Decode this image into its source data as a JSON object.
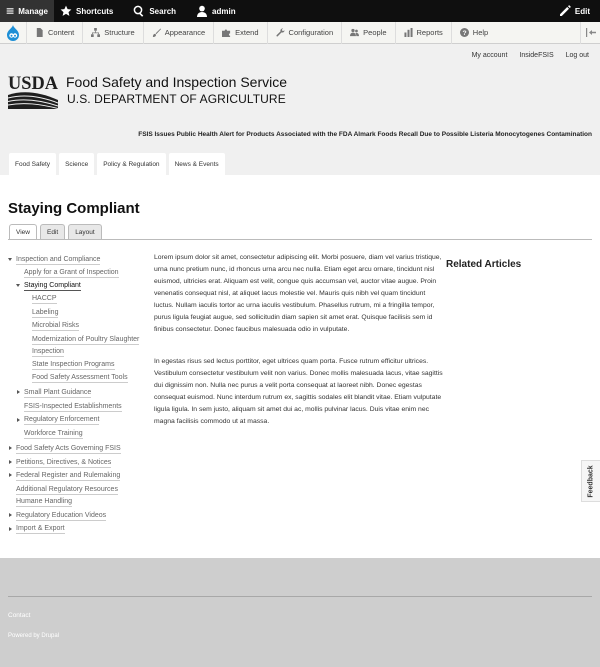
{
  "toolbar": {
    "manage": "Manage",
    "shortcuts": "Shortcuts",
    "search": "Search",
    "user": "admin",
    "edit": "Edit"
  },
  "tray": {
    "items": [
      "Content",
      "Structure",
      "Appearance",
      "Extend",
      "Configuration",
      "People",
      "Reports",
      "Help"
    ]
  },
  "header": {
    "secondary_nav": [
      "My account",
      "InsideFSIS",
      "Log out"
    ],
    "logo_text": "USDA",
    "site_name": "Food Safety and Inspection Service",
    "site_sub": "U.S. DEPARTMENT OF AGRICULTURE",
    "alert": "FSIS Issues Public Health Alert for Products Associated with the FDA Almark Foods Recall Due to Possible Listeria Monocytogenes Contamination",
    "main_nav": [
      "Food Safety",
      "Science",
      "Policy & Regulation",
      "News & Events"
    ]
  },
  "page": {
    "title": "Staying Compliant",
    "tabs": [
      "View",
      "Edit",
      "Layout"
    ],
    "related_title": "Related Articles",
    "paragraphs": [
      "Lorem ipsum dolor sit amet, consectetur adipiscing elit. Morbi posuere, diam vel varius tristique, urna nunc pretium nunc, id rhoncus urna arcu nec nulla. Etiam eget arcu ornare, tincidunt nisl euismod, ultricies erat. Aliquam est velit, congue quis accumsan vel, auctor vitae augue. Proin venenatis consequat nisl, at aliquet lacus molestie vel. Mauris quis nibh vel quam tincidunt luctus. Nullam iaculis tortor ac urna iaculis vestibulum. Phasellus rutrum, mi a fringilla tempor, purus ligula feugiat augue, sed sollicitudin diam sapien sit amet erat. Quisque facilisis sem id finibus consectetur. Donec faucibus malesuada odio in vulputate.",
      "In egestas risus sed lectus porttitor, eget ultrices quam porta. Fusce rutrum efficitur ultrices. Vestibulum consectetur vestibulum velit non varius. Donec mollis malesuada lacus, vitae sagittis dui dignissim non. Nulla nec purus a velit porta consequat at laoreet nibh. Donec egestas consequat euismod. Nunc interdum rutrum ex, sagittis sodales elit blandit vitae. Etiam vulputate ligula ligula. In sem justo, aliquam sit amet dui ac, mollis pulvinar lacus. Duis vitae enim nec magna facilisis commodo ut at massa."
    ]
  },
  "sidebar": {
    "items": [
      "Inspection and Compliance",
      "Apply for a Grant of Inspection",
      "Staying Compliant",
      "HACCP",
      "Labeling",
      "Microbial Risks",
      "Modernization of Poultry Slaughter",
      "Inspection",
      "State Inspection Programs",
      "Food Safety Assessment Tools",
      "Small Plant Guidance",
      "FSIS-Inspected Establishments",
      "Regulatory Enforcement",
      "Workforce Training",
      "Food Safety Acts Governing FSIS",
      "Petitions, Directives, & Notices",
      "Federal Register and Rulemaking",
      "Additional Regulatory Resources",
      "Humane Handling",
      "Regulatory Education Videos",
      "Import & Export"
    ]
  },
  "feedback": "Feedback",
  "footer": {
    "contact": "Contact",
    "powered": "Powered by Drupal"
  }
}
